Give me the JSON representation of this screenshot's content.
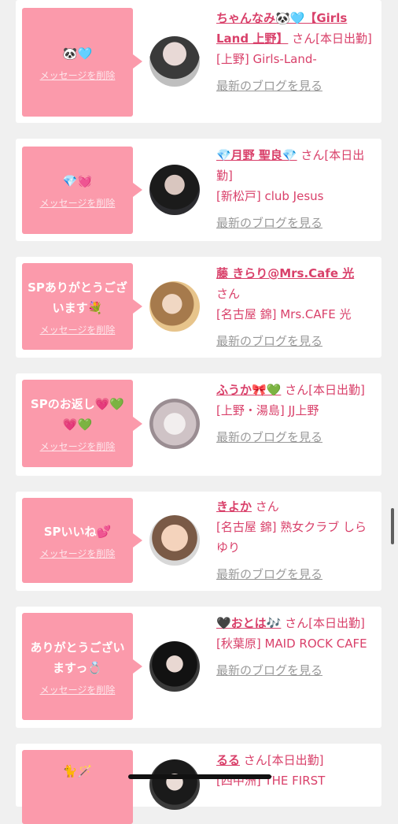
{
  "labels": {
    "delete": "メッセージを削除",
    "blog": "最新のブログを見る",
    "san": "さん"
  },
  "cards": [
    {
      "message": "🐼🩵",
      "name": "ちゃんなみ🐼🩵【Girls Land 上野】",
      "status": "[本日出勤]",
      "shop": "[上野] Girls-Land-"
    },
    {
      "message": "💎💓",
      "name": "💎月野 聖良💎",
      "status": "[本日出勤]",
      "shop": "[新松戸] club Jesus"
    },
    {
      "message": "SPありがとうございます💐",
      "name": "藤 きらり@Mrs.Cafe 光",
      "status": "",
      "shop": "[名古屋 錦] Mrs.CAFE 光"
    },
    {
      "message": "SPのお返し💗💚💗💚",
      "name": "ふうか🎀💚",
      "status": "[本日出勤]",
      "shop": "[上野・湯島] JJ上野"
    },
    {
      "message": "SPいいね💕",
      "name": "きよか",
      "status": "",
      "shop": "[名古屋 錦] 熟女クラブ しらゆり"
    },
    {
      "message": "ありがとうございますっ💍",
      "name": "🖤おとは🎶",
      "status": "[本日出勤]",
      "shop": "[秋葉原] MAID ROCK CAFE"
    },
    {
      "message": "🐈🪄",
      "name": "るる",
      "status": "[本日出勤]",
      "shop": "[四中洲] THE FIRST"
    }
  ]
}
